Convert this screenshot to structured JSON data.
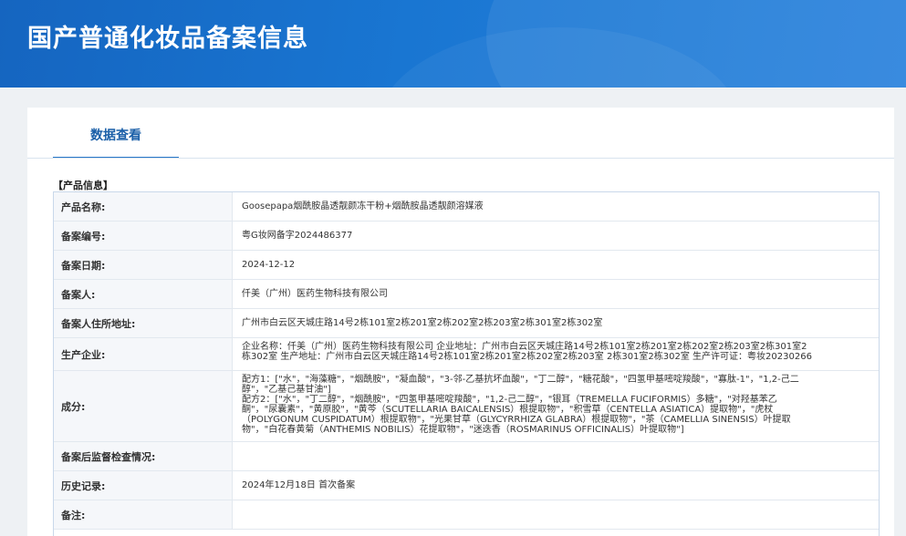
{
  "banner": {
    "title": "国产普通化妆品备案信息"
  },
  "tabs": {
    "active": "数据查看"
  },
  "section": {
    "title": "【产品信息】"
  },
  "fields": [
    {
      "label": "产品名称:",
      "value": "Goosepapa烟酰胺晶透靓颜冻干粉+烟酰胺晶透靓颜溶媒液"
    },
    {
      "label": "备案编号:",
      "value": "粤G妆网备字2024486377"
    },
    {
      "label": "备案日期:",
      "value": "2024-12-12"
    },
    {
      "label": "备案人:",
      "value": "仟美（广州）医药生物科技有限公司"
    },
    {
      "label": "备案人住所地址:",
      "value": "广州市白云区天城庄路14号2栋101室2栋201室2栋202室2栋203室2栋301室2栋302室"
    },
    {
      "label": "生产企业:",
      "lines": [
        "企业名称：仟美（广州）医药生物科技有限公司 企业地址：广州市白云区天城庄路14号2栋101室2栋201室2栋202室2栋203室2栋301室2",
        "栋302室 生产地址：广州市白云区天城庄路14号2栋101室2栋201室2栋202室2栋203室 2栋301室2栋302室 生产许可证：粤妆20230266"
      ]
    },
    {
      "label": "成分:",
      "lines": [
        "配方1：[\"水\"，\"海藻糖\"，\"烟酰胺\"，\"凝血酸\"，\"3-邻-乙基抗坏血酸\"，\"丁二醇\"，\"糖花酸\"，\"四氢甲基嘧啶羧酸\"，\"寡肽-1\"，\"1,2-己二",
        "醇\"，\"乙基己基甘油\"]",
        "配方2：[\"水\"，\"丁二醇\"，\"烟酰胺\"，\"四氢甲基嘧啶羧酸\"，\"1,2-己二醇\"，\"银耳（TREMELLA FUCIFORMIS）多糖\"，\"对羟基苯乙",
        "酮\"，\"尿囊素\"，\"黄原胶\"，\"黄芩（SCUTELLARIA BAICALENSIS）根提取物\"，\"积雪草（CENTELLA ASIATICA）提取物\"，\"虎杖",
        "（POLYGONUM CUSPIDATUM）根提取物\"，\"光果甘草（GLYCYRRHIZA GLABRA）根提取物\"，\"茶（CAMELLIA SINENSIS）叶提取",
        "物\"，\"白花春黄菊（ANTHEMIS NOBILIS）花提取物\"，\"迷迭香（ROSMARINUS OFFICINALIS）叶提取物\"]"
      ]
    },
    {
      "label": "备案后监督检查情况:",
      "value": ""
    },
    {
      "label": "历史记录:",
      "value": "2024年12月18日 首次备案"
    },
    {
      "label": "备注:",
      "value": ""
    }
  ]
}
